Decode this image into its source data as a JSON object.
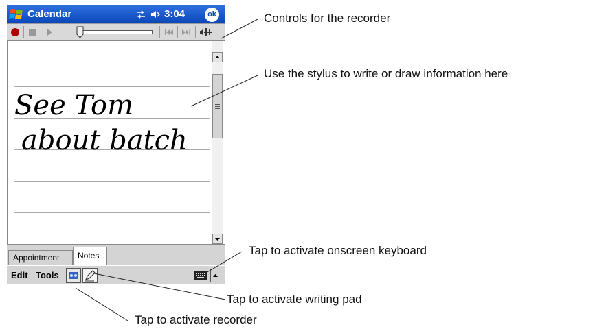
{
  "titlebar": {
    "app_title": "Calendar",
    "clock": "3:04",
    "ok_label": "ok"
  },
  "icons": {
    "start": "windows-flag-icon",
    "connectivity": "connectivity-arrows-icon",
    "volume": "speaker-icon",
    "record": "record-icon",
    "stop": "stop-icon",
    "play": "play-icon",
    "skip_back": "skip-back-icon",
    "skip_forward": "skip-forward-icon",
    "speaker_volume": "volume-icon",
    "recorder_toggle": "recorder-toggle-icon",
    "writing_pad": "pen-icon",
    "keyboard": "keyboard-icon",
    "sip_arrow": "chevron-up-icon"
  },
  "note": {
    "handwriting_lines": [
      "See Tom",
      "about batch"
    ]
  },
  "tabs": [
    {
      "label": "Appointment",
      "selected": false
    },
    {
      "label": "Notes",
      "selected": true
    }
  ],
  "menu": {
    "edit": "Edit",
    "tools": "Tools"
  },
  "callouts": {
    "recorder_controls": "Controls for the recorder",
    "stylus": "Use the stylus to write or draw information here",
    "keyboard": "Tap to activate onscreen keyboard",
    "writing_pad": "Tap to activate writing pad",
    "recorder": "Tap to activate recorder"
  },
  "colors": {
    "titlebar": "#0a46b8",
    "record_dot": "#b00000",
    "note_rule": "#aaaaaa"
  }
}
